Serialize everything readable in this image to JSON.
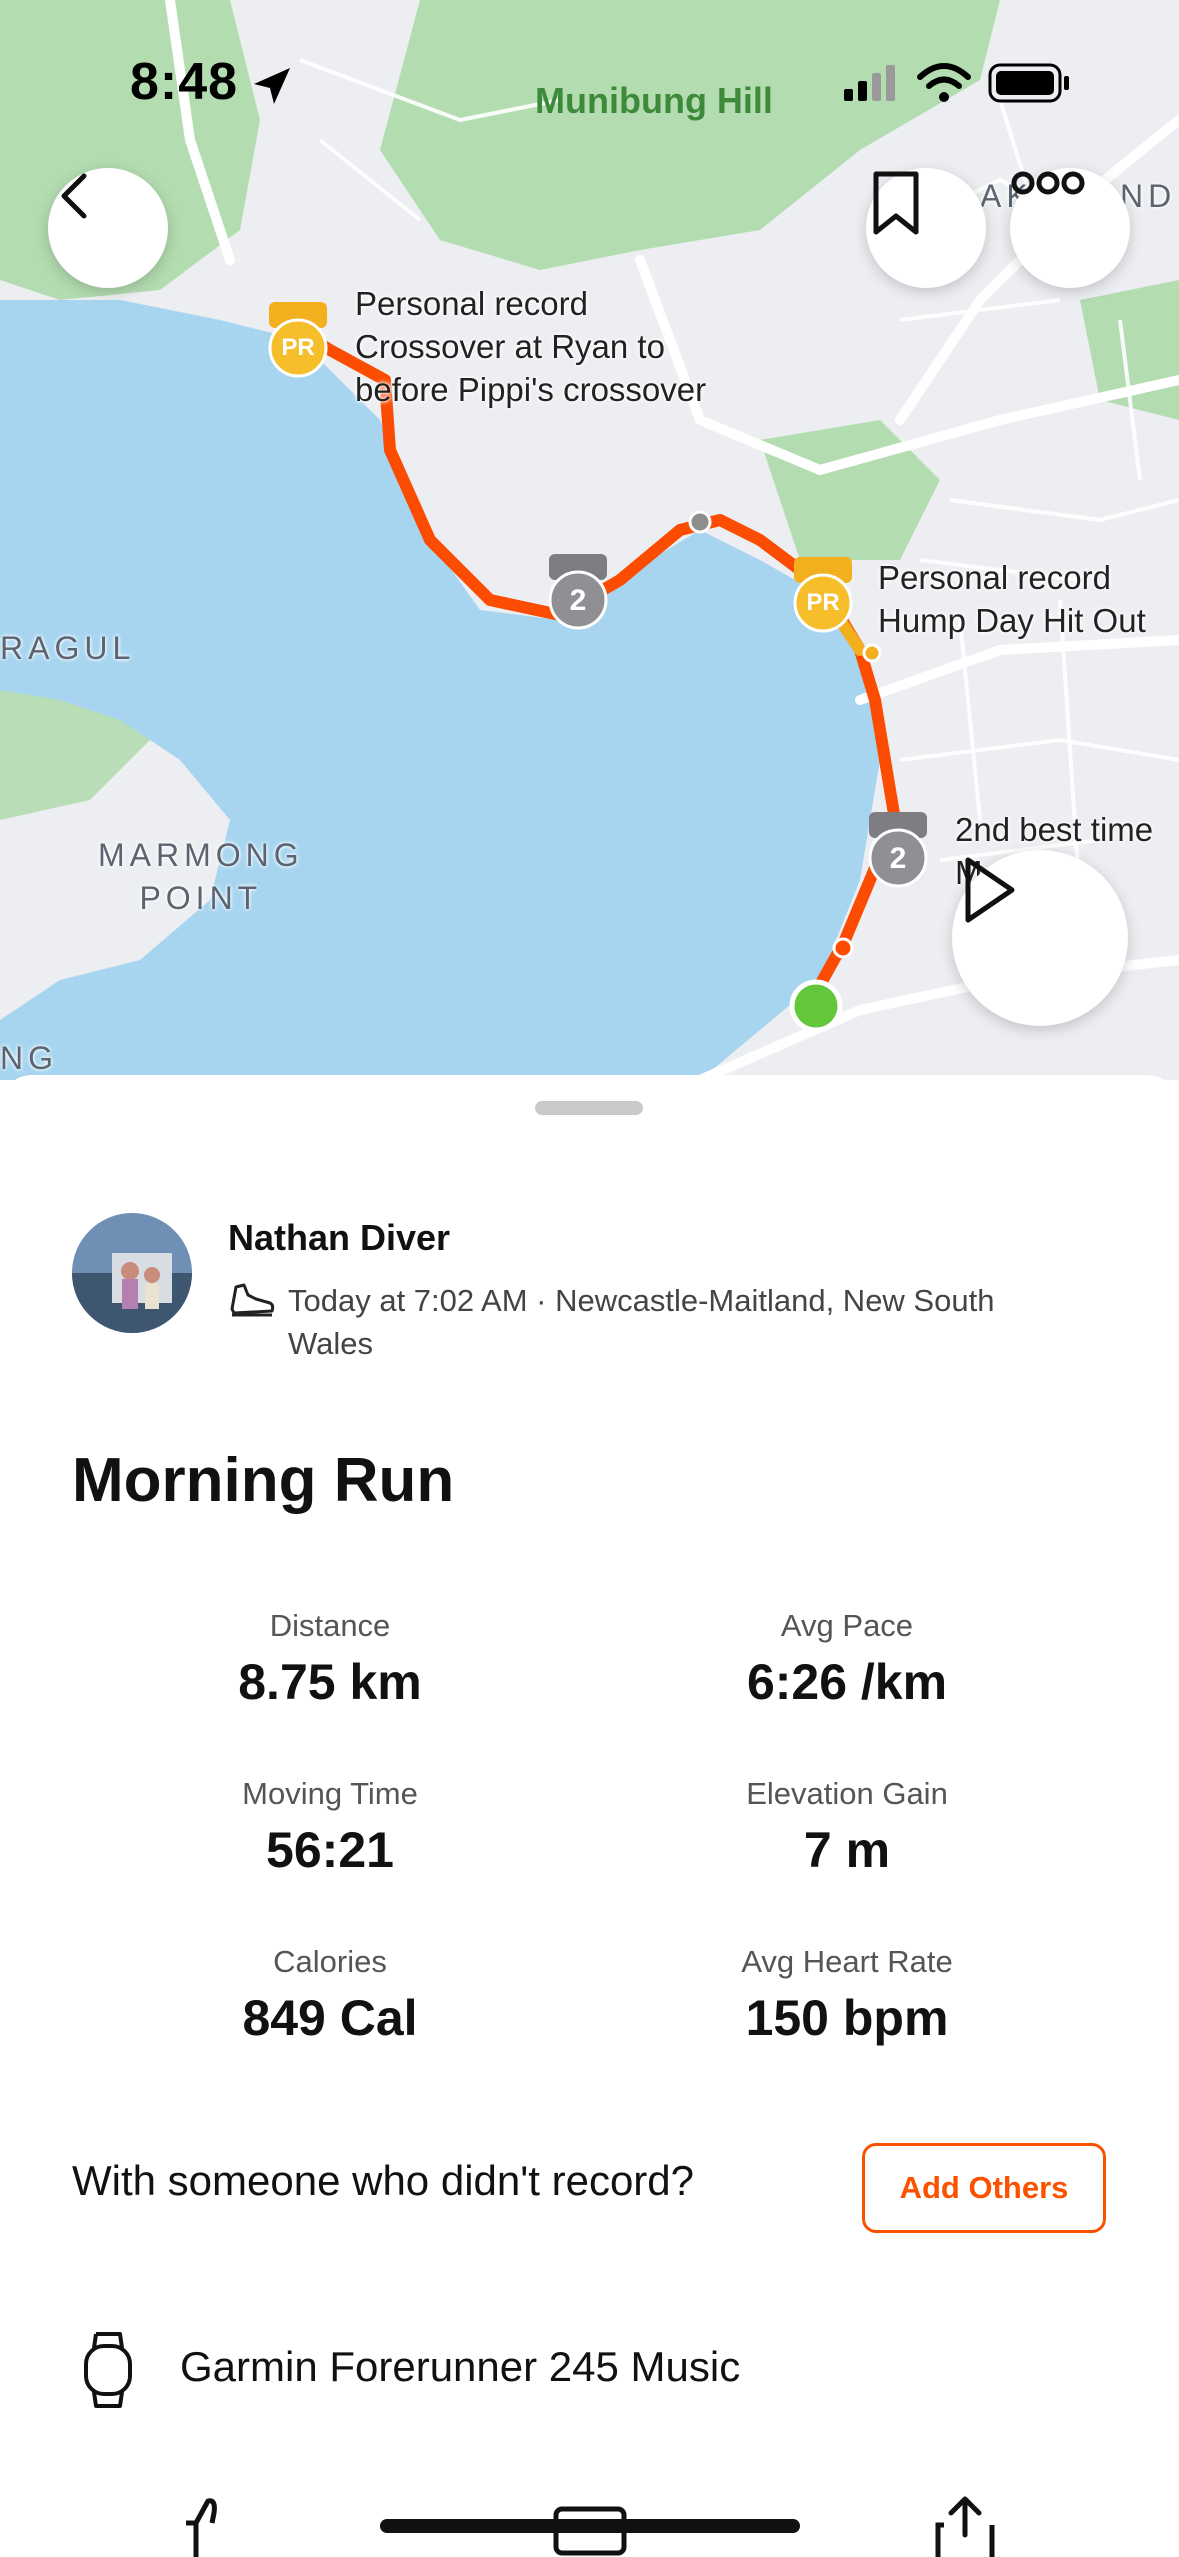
{
  "status_bar": {
    "time": "8:48",
    "map_title": "Munibung Hill"
  },
  "map": {
    "pr_label_1": [
      "Personal record",
      "Crossover at Ryan to",
      "before Pippi's crossover"
    ],
    "pr_label_2": [
      "Personal record",
      "Hump Day Hit Out"
    ],
    "segment_label_3": [
      "2nd best time",
      "M"
    ],
    "place_marmong": [
      "MARMONG",
      "POINT"
    ],
    "place_ragul": "RAGUL",
    "place_ng": "NG",
    "place_akd": "AK",
    "place_akd2": "ND",
    "pr_badge_text": "PR",
    "rank_badge_text": "2",
    "colors": {
      "route": "#fc4c02",
      "water": "#a7d5f0",
      "park": "#a8d6a6",
      "pr_gold": "#f2b01e"
    }
  },
  "activity": {
    "athlete_name": "Nathan Diver",
    "meta_line": "Today at 7:02 AM · Newcastle-Maitland, New South Wales",
    "title": "Morning Run",
    "stats": [
      {
        "label": "Distance",
        "value": "8.75 km"
      },
      {
        "label": "Avg Pace",
        "value": "6:26 /km"
      },
      {
        "label": "Moving Time",
        "value": "56:21"
      },
      {
        "label": "Elevation Gain",
        "value": "7 m"
      },
      {
        "label": "Calories",
        "value": "849 Cal"
      },
      {
        "label": "Avg Heart Rate",
        "value": "150 bpm"
      }
    ],
    "others_prompt": "With someone who didn't record?",
    "add_others_label": "Add Others",
    "device": "Garmin Forerunner 245 Music"
  },
  "icons": {
    "back": "chevron-left-icon",
    "bookmark": "bookmark-icon",
    "more": "more-icon",
    "play": "play-icon",
    "shoe": "shoe-icon",
    "watch": "watch-icon",
    "kudos": "thumbs-up-icon",
    "comment": "comment-icon",
    "share": "share-icon"
  },
  "brand_color": "#fc5200"
}
